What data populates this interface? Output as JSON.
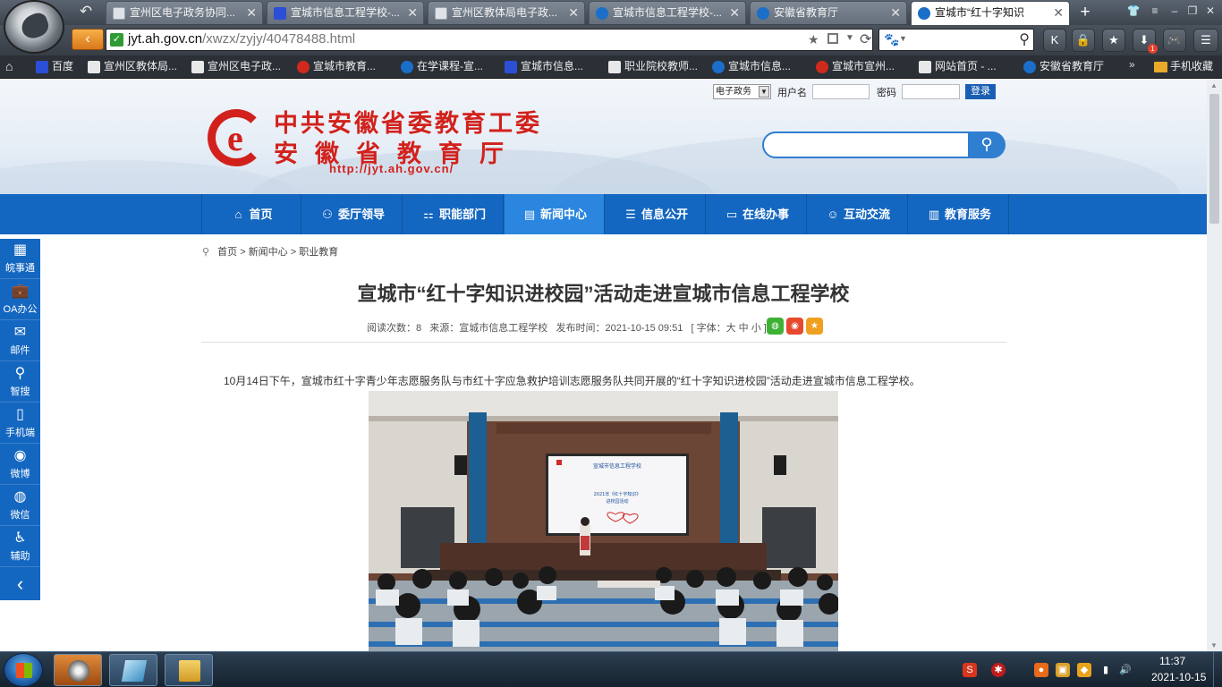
{
  "browser": {
    "tabs": [
      {
        "label": "宣州区电子政务协同...",
        "icon": "doc-icon"
      },
      {
        "label": "宣城市信息工程学校-...",
        "icon": "baidu-icon"
      },
      {
        "label": "宣州区教体局电子政...",
        "icon": "doc-icon"
      },
      {
        "label": "宣城市信息工程学校-...",
        "icon": "e-icon"
      },
      {
        "label": "安徽省教育厅",
        "icon": "e-icon"
      },
      {
        "label": "宣城市“红十字知识",
        "icon": "e-icon",
        "active": true
      }
    ],
    "url_host": "jyt.ah.gov.cn",
    "url_path": "/xwzx/zyjy/40478488.html",
    "new_tab_symbol": "+",
    "navbuttons": [
      "K",
      "🔒",
      "★",
      "⬇",
      "🎮",
      "☰"
    ],
    "download_badge": "1"
  },
  "bookmarks": [
    {
      "label": "百度",
      "icon": "baidu"
    },
    {
      "label": "宣州区教体局...",
      "icon": "doc"
    },
    {
      "label": "宣州区电子政...",
      "icon": "doc"
    },
    {
      "label": "宣城市教育...",
      "icon": "red"
    },
    {
      "label": "在学课程-宣...",
      "icon": "e"
    },
    {
      "label": "宣城市信息...",
      "icon": "baidu"
    },
    {
      "label": "职业院校教师...",
      "icon": "doc"
    },
    {
      "label": "宣城市信息...",
      "icon": "e"
    },
    {
      "label": "宣城市宣州...",
      "icon": "red"
    },
    {
      "label": "网站首页 - ...",
      "icon": "doc"
    },
    {
      "label": "安徽省教育厅",
      "icon": "e"
    }
  ],
  "bookmarks_folder": "手机收藏",
  "site": {
    "title_line1": "中共安徽省委教育工委",
    "title_line2": "安徽省教育厅",
    "site_url": "http://jyt.ah.gov.cn/",
    "login": {
      "system_select": "电子政务",
      "username_label": "用户名",
      "password_label": "密码",
      "login_button": "登录"
    }
  },
  "mainnav": [
    {
      "label": "首页",
      "icon": "home-icon"
    },
    {
      "label": "委厅领导",
      "icon": "people-icon"
    },
    {
      "label": "职能部门",
      "icon": "org-icon"
    },
    {
      "label": "新闻中心",
      "icon": "news-icon",
      "active": true
    },
    {
      "label": "信息公开",
      "icon": "list-icon"
    },
    {
      "label": "在线办事",
      "icon": "monitor-icon"
    },
    {
      "label": "互动交流",
      "icon": "chat-icon"
    },
    {
      "label": "教育服务",
      "icon": "book-icon"
    }
  ],
  "sidebar": [
    {
      "label": "皖事通",
      "icon": "qr-icon"
    },
    {
      "label": "OA办公",
      "icon": "briefcase-icon"
    },
    {
      "label": "邮件",
      "icon": "mail-icon"
    },
    {
      "label": "智搜",
      "icon": "search-icon"
    },
    {
      "label": "手机端",
      "icon": "phone-icon"
    },
    {
      "label": "微博",
      "icon": "weibo-icon"
    },
    {
      "label": "微信",
      "icon": "wechat-icon"
    },
    {
      "label": "辅助",
      "icon": "accessibility-icon"
    }
  ],
  "breadcrumb": {
    "home": "首页",
    "sep": ">",
    "section": "新闻中心",
    "subsection": "职业教育"
  },
  "article": {
    "title": "宣城市“红十字知识进校园”活动走进宣城市信息工程学校",
    "meta_reads": "阅读次数：8",
    "meta_source": "来源：宣城市信息工程学校",
    "meta_time": "发布时间：2021-10-15 09:51",
    "meta_font": "[ 字体：大 中 小 ]",
    "lead": "10月14日下午，宣城市红十字青少年志愿服务队与市红十字应急救护培训志愿服务队共同开展的“红十字知识进校园”活动走进宣城市信息工程学校。",
    "photo_screen_title": "宣城市信息工程学校",
    "photo_screen_sub1": "2021年《红十字知识》",
    "photo_screen_sub2": "进校园活动"
  },
  "taskbar": {
    "time": "11:37",
    "date": "2021-10-15"
  }
}
